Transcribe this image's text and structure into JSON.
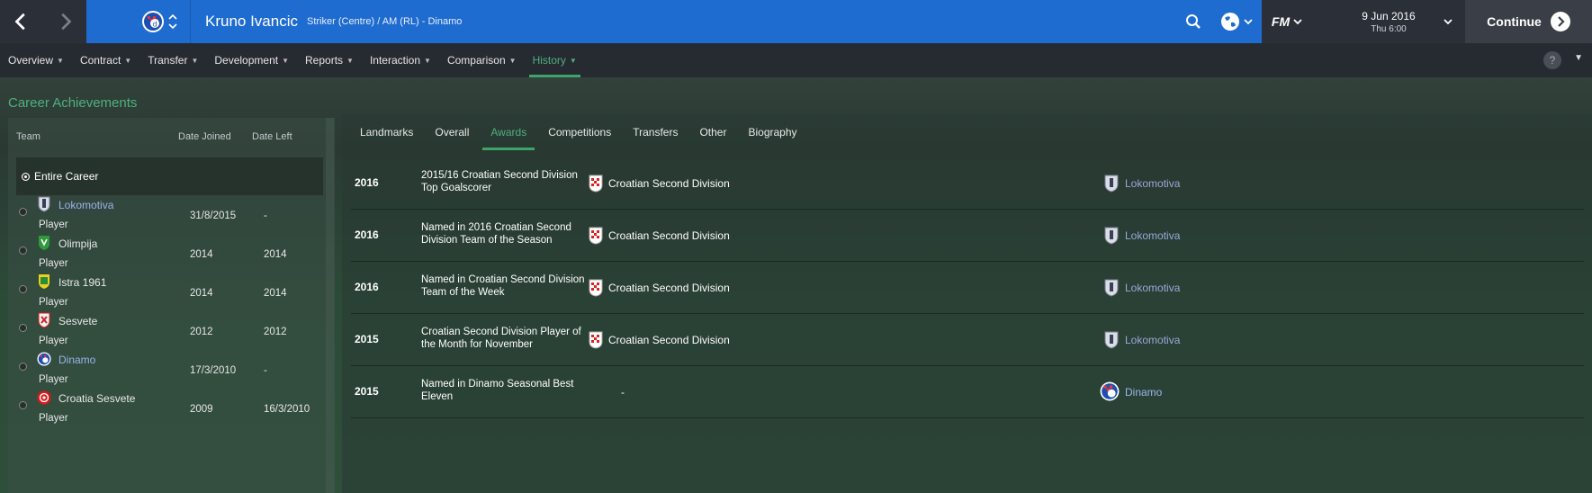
{
  "header": {
    "player_name": "Kruno Ivancic",
    "player_subtitle": "Striker (Centre) / AM (RL) - Dinamo",
    "date_main": "9 Jun 2016",
    "date_sub": "Thu 6:00",
    "continue_label": "Continue",
    "fm_label": "FM",
    "accent_color": "#1f6cd0"
  },
  "menu": {
    "items": [
      {
        "label": "Overview"
      },
      {
        "label": "Contract"
      },
      {
        "label": "Transfer"
      },
      {
        "label": "Development"
      },
      {
        "label": "Reports"
      },
      {
        "label": "Interaction"
      },
      {
        "label": "Comparison"
      },
      {
        "label": "History"
      }
    ],
    "active": "History",
    "help_label": "?"
  },
  "page": {
    "title": "Career Achievements"
  },
  "career": {
    "headers": {
      "team": "Team",
      "date_joined": "Date Joined",
      "date_left": "Date Left"
    },
    "entire_career_label": "Entire Career",
    "teams": [
      {
        "name": "Lokomotiva",
        "role": "Player",
        "joined": "31/8/2015",
        "left": "-",
        "link": true
      },
      {
        "name": "Olimpija",
        "role": "Player",
        "joined": "2014",
        "left": "2014",
        "link": false
      },
      {
        "name": "Istra 1961",
        "role": "Player",
        "joined": "2014",
        "left": "2014",
        "link": false
      },
      {
        "name": "Sesvete",
        "role": "Player",
        "joined": "2012",
        "left": "2012",
        "link": false
      },
      {
        "name": "Dinamo",
        "role": "Player",
        "joined": "17/3/2010",
        "left": "-",
        "link": true
      },
      {
        "name": "Croatia Sesvete",
        "role": "Player",
        "joined": "2009",
        "left": "16/3/2010",
        "link": false
      }
    ]
  },
  "tabs": {
    "items": [
      {
        "label": "Landmarks"
      },
      {
        "label": "Overall"
      },
      {
        "label": "Awards"
      },
      {
        "label": "Competitions"
      },
      {
        "label": "Transfers"
      },
      {
        "label": "Other"
      },
      {
        "label": "Biography"
      }
    ],
    "active": "Awards"
  },
  "awards": [
    {
      "year": "2016",
      "name": "2015/16 Croatian Second Division Top Goalscorer",
      "competition": "Croatian Second Division",
      "club": "Lokomotiva"
    },
    {
      "year": "2016",
      "name": "Named in 2016 Croatian Second Division Team of the Season",
      "competition": "Croatian Second Division",
      "club": "Lokomotiva"
    },
    {
      "year": "2016",
      "name": "Named in Croatian Second Division Team of the Week",
      "competition": "Croatian Second Division",
      "club": "Lokomotiva"
    },
    {
      "year": "2015",
      "name": "Croatian Second Division Player of the Month for November",
      "competition": "Croatian Second Division",
      "club": "Lokomotiva"
    },
    {
      "year": "2015",
      "name": "Named in Dinamo Seasonal Best Eleven",
      "competition": "-",
      "club": "Dinamo"
    }
  ]
}
